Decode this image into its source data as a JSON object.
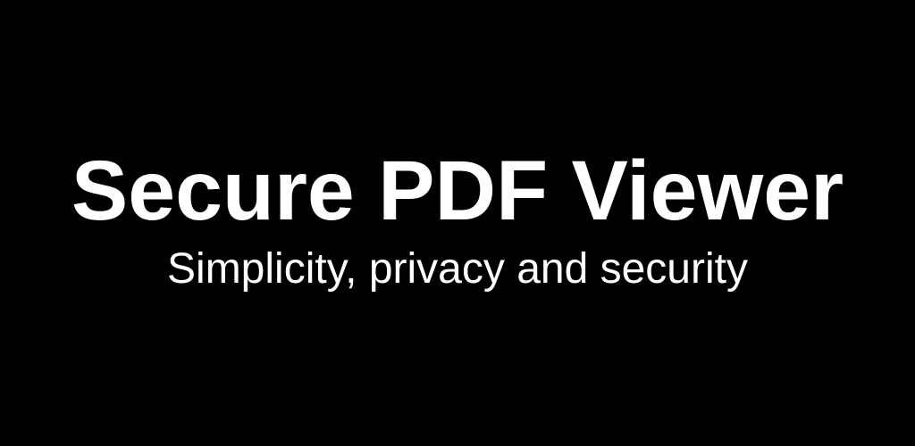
{
  "banner": {
    "title": "Secure PDF Viewer",
    "subtitle": "Simplicity, privacy and security",
    "background_color": "#000000",
    "text_color": "#ffffff"
  }
}
